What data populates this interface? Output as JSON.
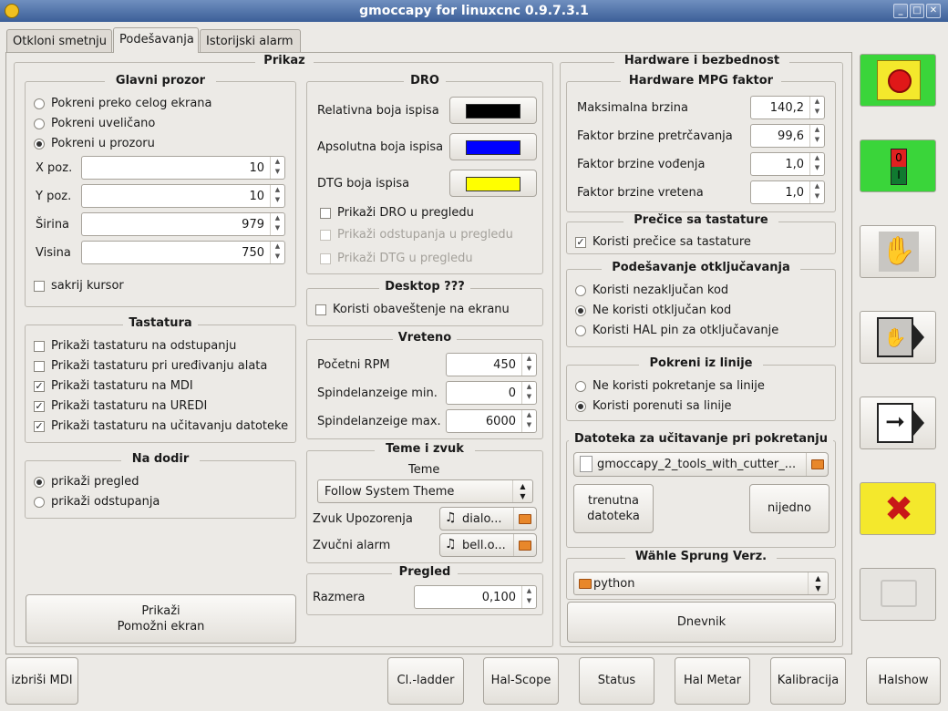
{
  "window": {
    "title": "gmoccapy for linuxcnc 0.9.7.3.1"
  },
  "tabs": [
    "Otkloni smetnju",
    "Podešavanja",
    "Istorijski alarm"
  ],
  "prikaz": {
    "title": "Prikaz",
    "glavni": {
      "title": "Glavni prozor",
      "options": [
        "Pokreni preko celog ekrana",
        "Pokreni uveličano",
        "Pokreni u prozoru"
      ],
      "selected": 2,
      "fields": [
        {
          "label": "X poz.",
          "value": "10"
        },
        {
          "label": "Y poz.",
          "value": "10"
        },
        {
          "label": "Širina",
          "value": "979"
        },
        {
          "label": "Visina",
          "value": "750"
        }
      ],
      "hide_cursor": "sakrij kursor"
    },
    "tastatura": {
      "title": "Tastatura",
      "items": [
        {
          "label": "Prikaži tastaturu na odstupanju",
          "checked": false
        },
        {
          "label": "Prikaži tastaturu pri uređivanju alata",
          "checked": false
        },
        {
          "label": "Prikaži tastaturu na MDI",
          "checked": true
        },
        {
          "label": "Prikaži tastaturu na UREDI",
          "checked": true
        },
        {
          "label": "Prikaži tastaturu na učitavanju datoteke",
          "checked": true
        }
      ]
    },
    "na_dodir": {
      "title": "Na dodir",
      "options": [
        "prikaži pregled",
        "prikaži odstupanja"
      ],
      "selected": 0
    },
    "aux_button": {
      "line1": "Prikaži",
      "line2": "Pomožni ekran"
    },
    "dro": {
      "title": "DRO",
      "colors": [
        {
          "label": "Relativna boja ispisa",
          "color": "#000000"
        },
        {
          "label": "Apsolutna boja ispisa",
          "color": "#0000ff"
        },
        {
          "label": "DTG boja ispisa",
          "color": "#ffff00"
        }
      ],
      "checks": [
        {
          "label": "Prikaži DRO u pregledu",
          "checked": false,
          "disabled": false
        },
        {
          "label": "Prikaži odstupanja u pregledu",
          "checked": false,
          "disabled": true
        },
        {
          "label": "Prikaži DTG u pregledu",
          "checked": false,
          "disabled": true
        }
      ]
    },
    "desktop": {
      "title": "Desktop ???",
      "notify": "Koristi obaveštenje na ekranu"
    },
    "vreteno": {
      "title": "Vreteno",
      "fields": [
        {
          "label": "Početni RPM",
          "value": "450"
        },
        {
          "label": "Spindelanzeige min.",
          "value": "0"
        },
        {
          "label": "Spindelanzeige max.",
          "value": "6000"
        }
      ]
    },
    "teme": {
      "title": "Teme i zvuk",
      "theme_label": "Teme",
      "theme_value": "Follow System Theme",
      "alarm_label": "Zvuk Upozorenja",
      "alarm_file": "dialo...",
      "bell_label": "Zvučni alarm",
      "bell_file": "bell.o..."
    },
    "pregled": {
      "title": "Pregled",
      "label": "Razmera",
      "value": "0,100"
    }
  },
  "hardware": {
    "title": "Hardware i bezbednost",
    "mpg": {
      "title": "Hardware MPG faktor",
      "fields": [
        {
          "label": "Maksimalna brzina",
          "value": "140,2"
        },
        {
          "label": "Faktor brzine pretrčavanja",
          "value": "99,6"
        },
        {
          "label": "Faktor brzine vođenja",
          "value": "1,0"
        },
        {
          "label": "Faktor brzine vretena",
          "value": "1,0"
        }
      ]
    },
    "precice": {
      "title": "Prečice sa tastature",
      "label": "Koristi prečice sa tastature",
      "checked": true
    },
    "otkljucavanje": {
      "title": "Podešavanje otključavanja",
      "options": [
        "Koristi nezaključan kod",
        "Ne koristi otključan kod",
        "Koristi HAL pin za otključavanje"
      ],
      "selected": 1
    },
    "linija": {
      "title": "Pokreni iz linije",
      "options": [
        "Ne koristi pokretanje sa linije",
        "Koristi porenuti sa linije"
      ],
      "selected": 1
    },
    "datoteka": {
      "title": "Datoteka za učitavanje pri pokretanju",
      "file": "gmoccapy_2_tools_with_cutter_...",
      "current_line1": "trenutna",
      "current_line2": "datoteka",
      "none": "nijedno"
    },
    "sprung": {
      "title": "Wähle Sprung Verz.",
      "value": "python"
    },
    "log_button": "Dnevnik"
  },
  "side_buttons": [
    {
      "name": "estop-button",
      "icon": "emergency-stop-icon",
      "bg": "#3ad53a"
    },
    {
      "name": "machine-power-button",
      "icon": "power-toggle-icon",
      "bg": "#3ad53a"
    },
    {
      "name": "manual-mode-button",
      "icon": "hand-icon",
      "bg": ""
    },
    {
      "name": "mdi-mode-button",
      "icon": "hand-arrow-icon",
      "bg": ""
    },
    {
      "name": "auto-mode-button",
      "icon": "arrow-right-icon",
      "bg": ""
    },
    {
      "name": "settings-button",
      "icon": "tools-icon",
      "bg": "#f4e82c"
    },
    {
      "name": "user-tabs-button",
      "icon": "user-tabs-icon",
      "bg": ""
    }
  ],
  "bottom": {
    "clear_mdi": "izbriši MDI",
    "buttons": [
      "Cl.-ladder",
      "Hal-Scope",
      "Status",
      "Hal Metar",
      "Kalibracija"
    ],
    "halshow": "Halshow"
  }
}
